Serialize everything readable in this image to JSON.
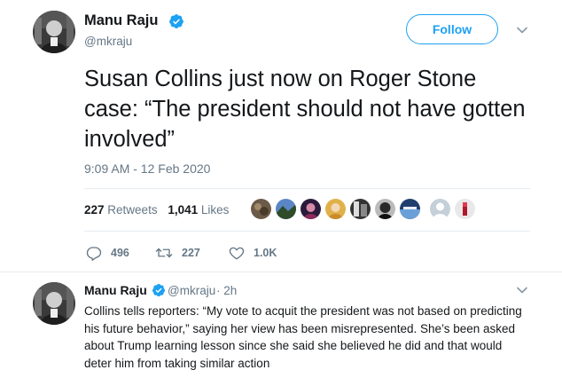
{
  "main_tweet": {
    "author_name": "Manu Raju",
    "author_handle": "@mkraju",
    "follow_label": "Follow",
    "text": "Susan Collins just now on Roger Stone case: “The president should not have gotten involved”",
    "timestamp": "9:09 AM - 12 Feb 2020",
    "retweets_count": "227",
    "retweets_label": "Retweets",
    "likes_count": "1,041",
    "likes_label": "Likes",
    "actions": {
      "reply_count": "496",
      "retweet_count": "227",
      "like_count": "1.0K"
    }
  },
  "reply_tweet": {
    "author_name": "Manu Raju",
    "author_handle": "@mkraju",
    "time_ago": "· 2h",
    "text": "Collins tells reporters: “My vote to acquit the president was not based on predicting his future behavior,” saying her view has been misrepresented. She’s been asked about Trump learning lesson since she said she believed he did and that would deter him from taking similar action"
  },
  "colors": {
    "accent": "#1da1f2",
    "muted": "#657786",
    "text": "#14171a",
    "divider": "#e6ecf0"
  },
  "icons": [
    "verified-badge-icon",
    "chevron-down-icon",
    "reply-icon",
    "retweet-icon",
    "heart-icon"
  ]
}
